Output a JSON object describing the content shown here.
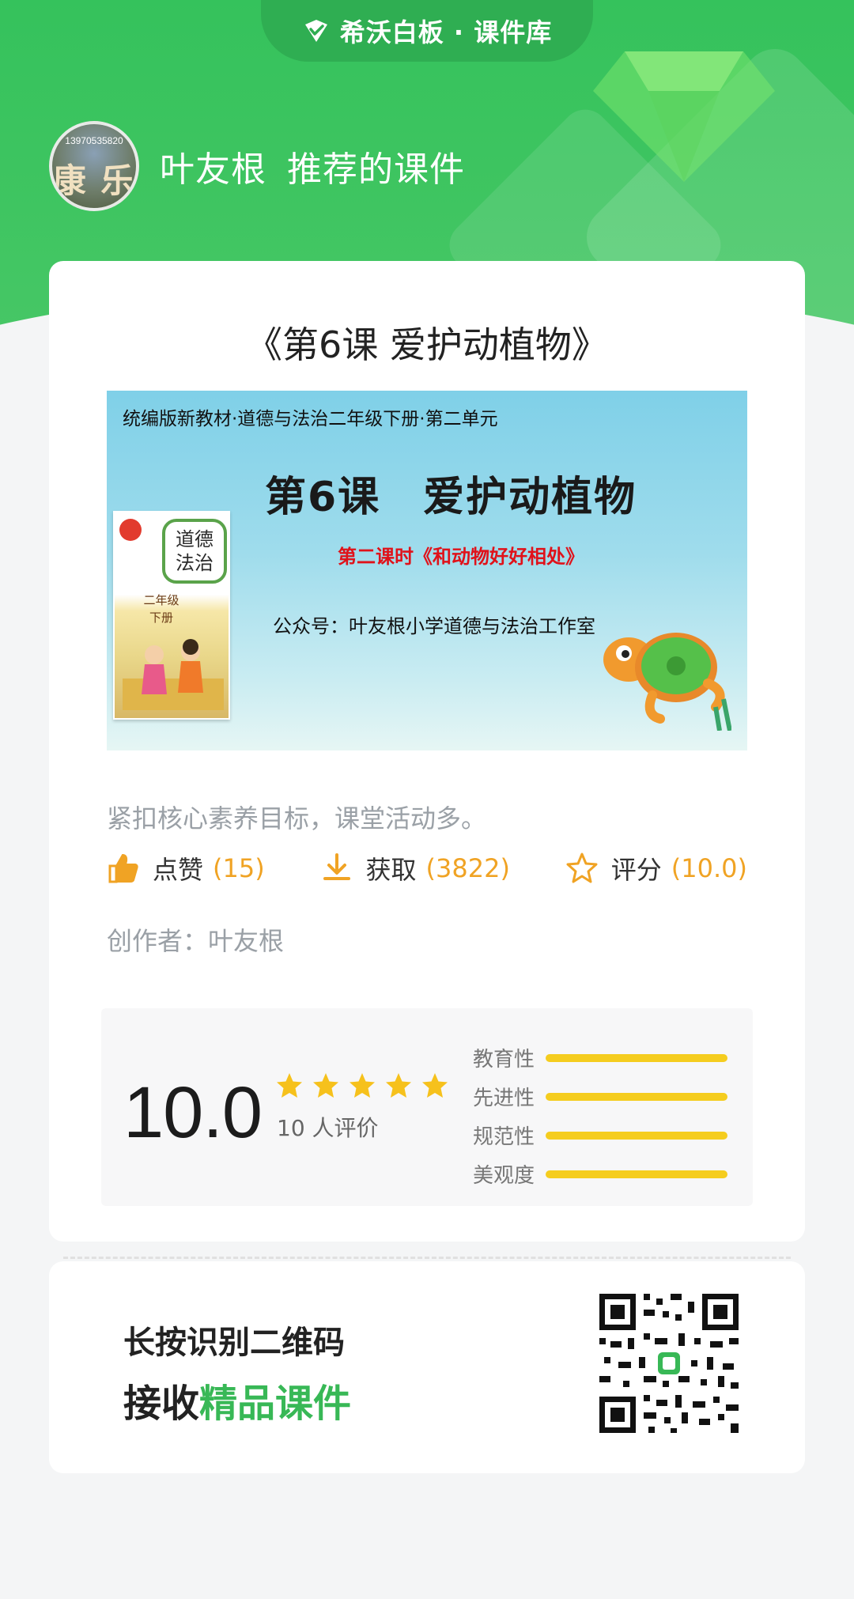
{
  "brand": {
    "name": "希沃白板 · 课件库",
    "accent": "#38b856"
  },
  "author": {
    "avatar_phone": "13970535820",
    "avatar_text": "康 乐",
    "name": "叶友根",
    "recommend": "推荐的课件"
  },
  "course": {
    "title": "《第6课 爱护动植物》",
    "cover": {
      "series": "统编版新教材·道德与法治二年级下册·第二单元",
      "title": "第6课　爱护动植物",
      "subtitle": "第二课时《和动物好好相处》",
      "publisher": "公众号：叶友根小学道德与法治工作室",
      "book_title_1": "道德",
      "book_title_2": "法治",
      "book_grade": "二年级",
      "book_volume": "下册"
    },
    "description": "紧扣核心素养目标，课堂活动多。",
    "stats": {
      "like_label": "点赞",
      "like_count": "(15)",
      "get_label": "获取",
      "get_count": "(3822)",
      "rate_label": "评分",
      "rate_count": "(10.0)"
    },
    "creator": "创作者：叶友根"
  },
  "rating": {
    "score": "10.0",
    "stars": 5,
    "reviews": "10 人评价",
    "dimensions": [
      {
        "label": "教育性",
        "value": 1.0
      },
      {
        "label": "先进性",
        "value": 1.0
      },
      {
        "label": "规范性",
        "value": 1.0
      },
      {
        "label": "美观度",
        "value": 1.0
      }
    ],
    "bar_color": "#f5cd1f",
    "star_color": "#f6c11c"
  },
  "qr": {
    "line1": "长按识别二维码",
    "line2_prefix": "接收",
    "line2_highlight": "精品课件"
  }
}
